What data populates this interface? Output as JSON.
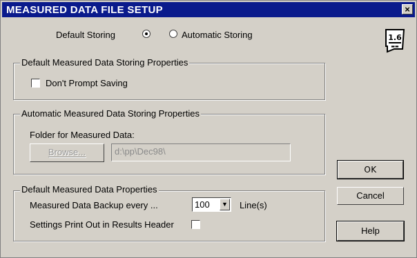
{
  "window": {
    "title": "MEASURED DATA FILE SETUP",
    "close_symbol": "×",
    "icon": "version-badge-icon",
    "icon_text": "1.6"
  },
  "storing": {
    "label": "Default Storing",
    "selected": "default",
    "automatic_label": "Automatic Storing"
  },
  "default_props": {
    "title": "Default Measured Data Storing Properties",
    "dont_prompt_label": "Don't Prompt Saving",
    "dont_prompt_checked": false
  },
  "automatic_props": {
    "title": "Automatic Measured Data Storing Properties",
    "folder_label": "Folder for Measured Data:",
    "browse_label": "Browse...",
    "browse_disabled": true,
    "folder_value": "d:\\pp\\Dec98\\"
  },
  "data_props": {
    "title": "Default Measured Data Properties",
    "backup_label": "Measured Data Backup every ...",
    "backup_value": "100",
    "backup_unit": "Line(s)",
    "print_label": "Settings Print Out in Results Header",
    "print_checked": false
  },
  "buttons": {
    "ok": "OK",
    "cancel": "Cancel",
    "help": "Help"
  },
  "colors": {
    "titlebar": "#0a1a8c",
    "face": "#d4d0c8"
  }
}
